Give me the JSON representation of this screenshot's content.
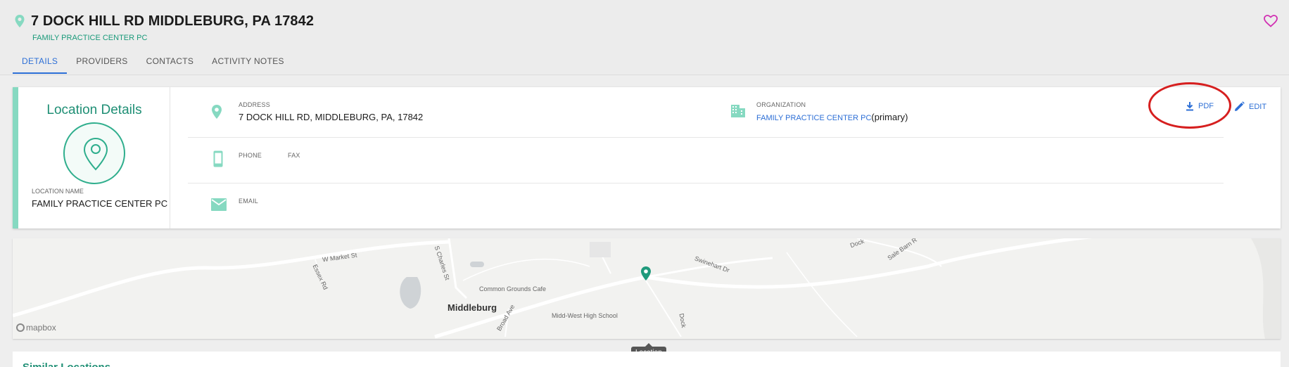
{
  "header": {
    "title": "7 DOCK HILL RD MIDDLEBURG, PA 17842",
    "subtitle": "FAMILY PRACTICE CENTER PC"
  },
  "tabs": [
    {
      "label": "DETAILS",
      "active": true
    },
    {
      "label": "PROVIDERS",
      "active": false
    },
    {
      "label": "CONTACTS",
      "active": false
    },
    {
      "label": "ACTIVITY NOTES",
      "active": false
    }
  ],
  "details": {
    "panel_title": "Location Details",
    "location_name_label": "LOCATION NAME",
    "location_name": "FAMILY PRACTICE CENTER PC",
    "address_label": "ADDRESS",
    "address": "7 DOCK HILL RD, MIDDLEBURG, PA, 17842",
    "organization_label": "ORGANIZATION",
    "organization_link": "FAMILY PRACTICE CENTER PC",
    "organization_suffix": "(primary)",
    "phone_label": "PHONE",
    "fax_label": "FAX",
    "email_label": "EMAIL"
  },
  "actions": {
    "pdf_label": "PDF",
    "edit_label": "EDIT"
  },
  "map": {
    "streets": [
      "W Market St",
      "S Charles St",
      "Essex Rd",
      "Swinehart Dr",
      "Sale Barn R",
      "Broad Ave",
      "Dock",
      "Dock"
    ],
    "places": [
      "Common Grounds Cafe",
      "Midd-West High School"
    ],
    "town": "Middleburg",
    "credit": "mapbox",
    "tooltip": "Location"
  },
  "bottom": {
    "title": "Similar Locations"
  },
  "colors": {
    "accent_teal": "#1f8f75",
    "link_blue": "#2d6fd6",
    "highlight_red": "#d61f1f",
    "favorite_pink": "#d12fb2"
  }
}
